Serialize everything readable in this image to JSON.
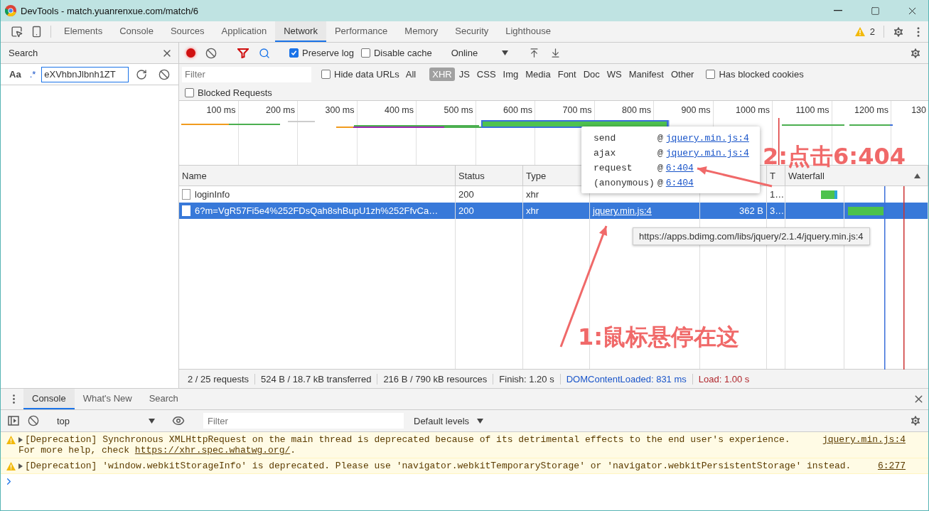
{
  "window": {
    "title": "DevTools - match.yuanrenxue.com/match/6"
  },
  "panel_tabs": [
    {
      "label": "Elements",
      "selected": false
    },
    {
      "label": "Console",
      "selected": false
    },
    {
      "label": "Sources",
      "selected": false
    },
    {
      "label": "Application",
      "selected": false
    },
    {
      "label": "Network",
      "selected": true
    },
    {
      "label": "Performance",
      "selected": false
    },
    {
      "label": "Memory",
      "selected": false
    },
    {
      "label": "Security",
      "selected": false
    },
    {
      "label": "Lighthouse",
      "selected": false
    }
  ],
  "warnings": {
    "count": "2"
  },
  "search_panel": {
    "title": "Search",
    "match_case": "Aa",
    "regex": ".*",
    "query": "eXVhbnJlbnh1ZT"
  },
  "network_toolbar": {
    "recording": true,
    "filter_active": true,
    "preserve_log": {
      "label": "Preserve log",
      "checked": true
    },
    "disable_cache": {
      "label": "Disable cache",
      "checked": false
    },
    "throttling": "Online"
  },
  "filter_bar": {
    "placeholder": "Filter",
    "hide_data_urls": {
      "label": "Hide data URLs",
      "checked": false
    },
    "types": [
      {
        "label": "All",
        "selected": false
      },
      {
        "label": "XHR",
        "selected": true
      },
      {
        "label": "JS",
        "selected": false
      },
      {
        "label": "CSS",
        "selected": false
      },
      {
        "label": "Img",
        "selected": false
      },
      {
        "label": "Media",
        "selected": false
      },
      {
        "label": "Font",
        "selected": false
      },
      {
        "label": "Doc",
        "selected": false
      },
      {
        "label": "WS",
        "selected": false
      },
      {
        "label": "Manifest",
        "selected": false
      },
      {
        "label": "Other",
        "selected": false
      }
    ],
    "has_blocked_cookies": {
      "label": "Has blocked cookies",
      "checked": false
    },
    "blocked_requests": {
      "label": "Blocked Requests",
      "checked": false
    }
  },
  "overview": {
    "ticks": [
      "100 ms",
      "200 ms",
      "300 ms",
      "400 ms",
      "500 ms",
      "600 ms",
      "700 ms",
      "800 ms",
      "900 ms",
      "1000 ms",
      "1100 ms",
      "1200 ms",
      "130"
    ]
  },
  "requests": {
    "columns": [
      "Name",
      "Status",
      "Type",
      null,
      null,
      "T",
      "Waterfall"
    ],
    "rows": [
      {
        "name": "loginInfo",
        "status": "200",
        "type": "xhr",
        "time": "1…",
        "selected": false
      },
      {
        "name": "6?m=VgR57Fi5e4%252FDsQah8shBupU1zh%252FfvCa…",
        "status": "200",
        "type": "xhr",
        "initiator": "jquery.min.js:4",
        "size": "362 B",
        "time": "3…",
        "selected": true
      }
    ]
  },
  "call_stack": [
    {
      "function": "send",
      "at": "@",
      "location": "jquery.min.js:4"
    },
    {
      "function": "ajax",
      "at": "@",
      "location": "jquery.min.js:4"
    },
    {
      "function": "request",
      "at": "@",
      "location": "6:404"
    },
    {
      "function": "(anonymous)",
      "at": "@",
      "location": "6:404"
    }
  ],
  "tooltip": "https://apps.bdimg.com/libs/jquery/2.1.4/jquery.min.js:4",
  "status_bar": [
    {
      "text": "2 / 25 requests",
      "kind": "plain"
    },
    {
      "text": "524 B / 18.7 kB transferred",
      "kind": "plain"
    },
    {
      "text": "216 B / 790 kB resources",
      "kind": "plain"
    },
    {
      "text": "Finish: 1.20 s",
      "kind": "plain"
    },
    {
      "text": "DOMContentLoaded: 831 ms",
      "kind": "dom"
    },
    {
      "text": "Load: 1.00 s",
      "kind": "load"
    }
  ],
  "drawer": {
    "tabs": [
      {
        "label": "Console",
        "selected": true
      },
      {
        "label": "What's New",
        "selected": false
      },
      {
        "label": "Search",
        "selected": false
      }
    ],
    "context": "top",
    "filter_placeholder": "Filter",
    "levels": "Default levels",
    "messages": [
      {
        "text": "[Deprecation] Synchronous XMLHttpRequest on the main thread is deprecated because of its detrimental effects to the end user's experience.",
        "help": "For more help, check ",
        "help_link": "https://xhr.spec.whatwg.org/",
        "help_end": ".",
        "source": "jquery.min.js:4"
      },
      {
        "text": "[Deprecation] 'window.webkitStorageInfo' is deprecated. Please use 'navigator.webkitTemporaryStorage' or 'navigator.webkitPersistentStorage' instead.",
        "source": "6:277"
      }
    ]
  },
  "annotations": [
    {
      "text": "1:鼠标悬停在这"
    },
    {
      "text": "2:点击6:404"
    }
  ]
}
